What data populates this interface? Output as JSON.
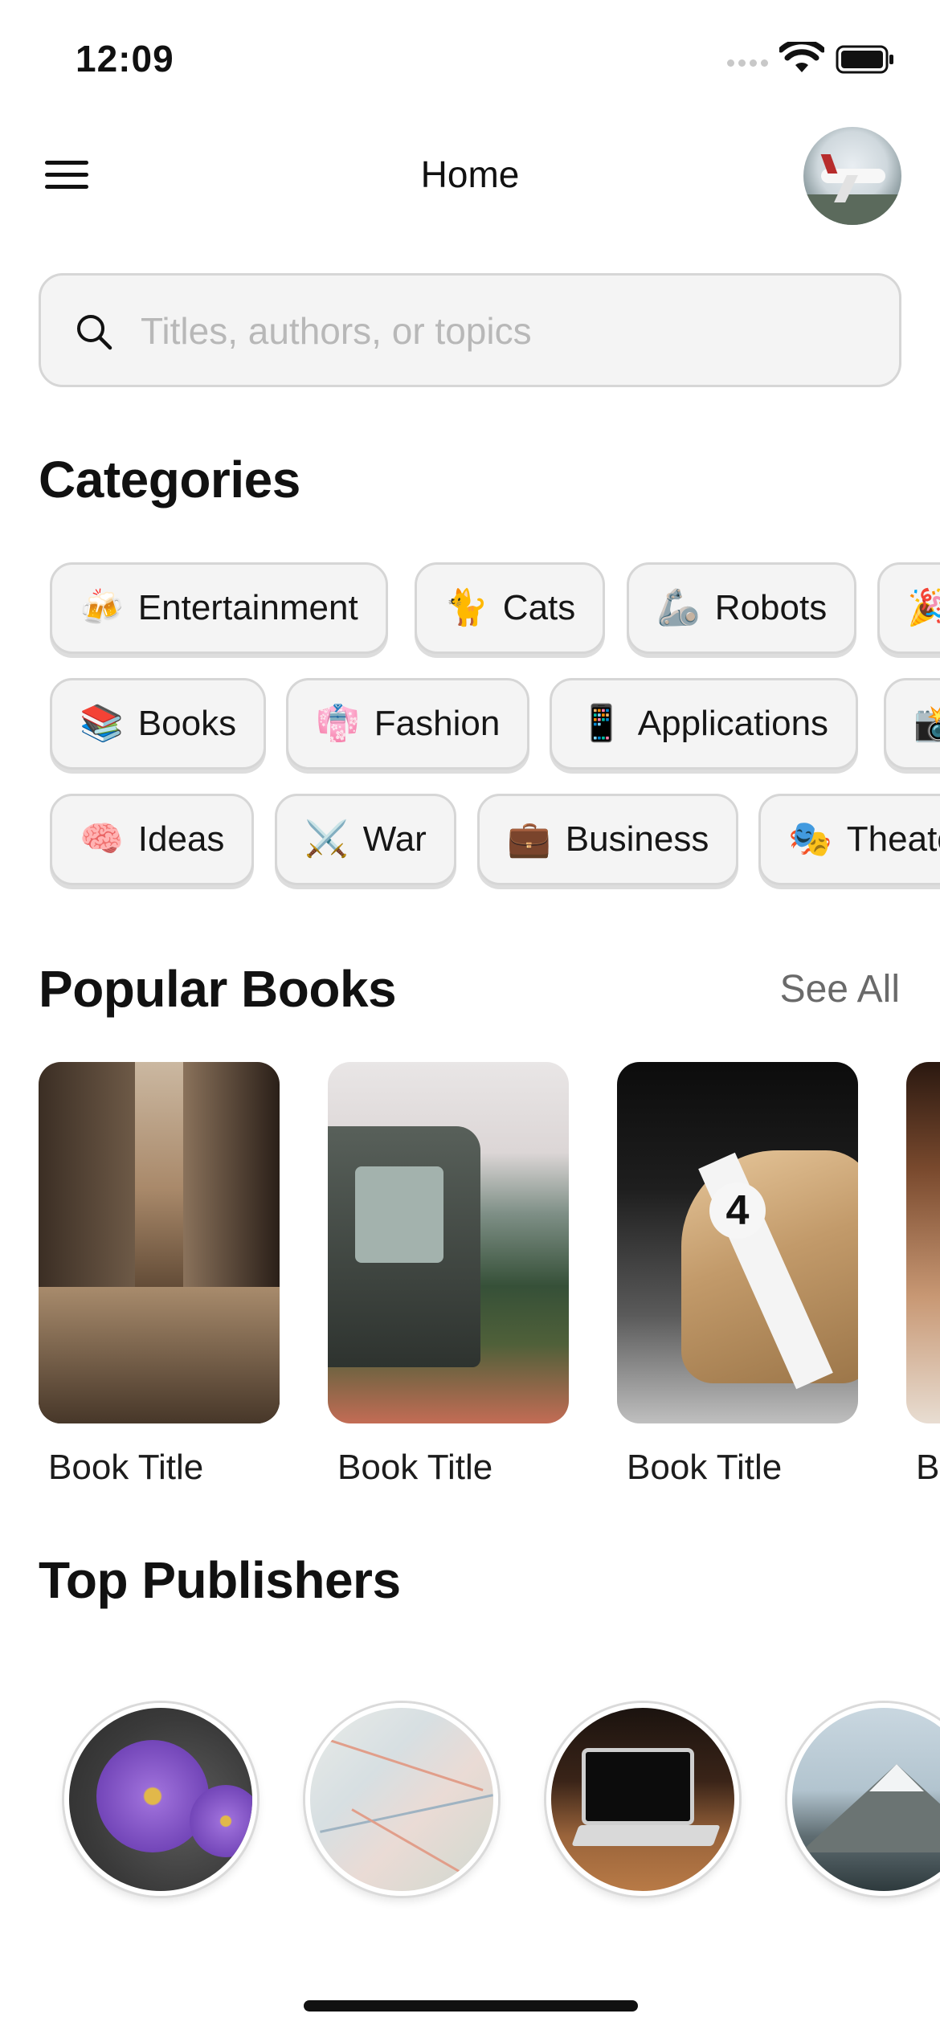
{
  "status_bar": {
    "time": "12:09"
  },
  "nav": {
    "title": "Home",
    "menu_icon": "hamburger-menu-icon",
    "avatar": "profile-avatar"
  },
  "search": {
    "placeholder": "Titles, authors, or topics",
    "value": "",
    "icon": "magnifier-icon"
  },
  "categories": {
    "title": "Categories",
    "rows": [
      [
        {
          "emoji": "🍻",
          "label": "Entertainment"
        },
        {
          "emoji": "🐈",
          "label": "Cats"
        },
        {
          "emoji": "🦾",
          "label": "Robots"
        },
        {
          "emoji": "🎉",
          "label": ""
        }
      ],
      [
        {
          "emoji": "📚",
          "label": "Books"
        },
        {
          "emoji": "👘",
          "label": "Fashion"
        },
        {
          "emoji": "📱",
          "label": "Applications"
        },
        {
          "emoji": "📸",
          "label": ""
        }
      ],
      [
        {
          "emoji": "🧠",
          "label": "Ideas"
        },
        {
          "emoji": "⚔️",
          "label": "War"
        },
        {
          "emoji": "💼",
          "label": "Business"
        },
        {
          "emoji": "🎭",
          "label": "Theate"
        }
      ]
    ]
  },
  "popular_books": {
    "title": "Popular Books",
    "see_all": "See All",
    "items": [
      {
        "title": "Book Title",
        "cover": "alley"
      },
      {
        "title": "Book Title",
        "cover": "jeep"
      },
      {
        "title": "Book Title",
        "cover": "race-car",
        "cover_number": "4"
      },
      {
        "title": "B",
        "cover": "partial"
      }
    ]
  },
  "top_publishers": {
    "title": "Top Publishers",
    "items": [
      {
        "image": "purple-flower"
      },
      {
        "image": "map"
      },
      {
        "image": "laptop"
      },
      {
        "image": "mountain"
      }
    ]
  },
  "colors": {
    "background": "#ffffff",
    "chip_bg": "#f4f4f4",
    "chip_border": "#d6d6d6",
    "muted_text": "#6a6a6a"
  }
}
